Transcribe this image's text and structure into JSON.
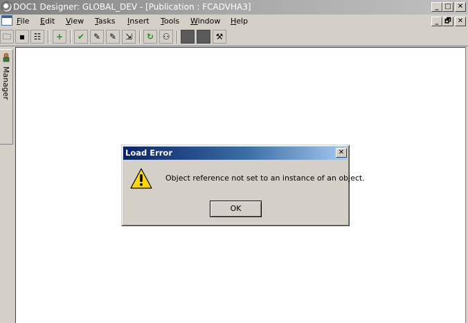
{
  "window": {
    "title": "DOC1 Designer: GLOBAL_DEV - [Publication : FCADVHA3]",
    "icon": "doc1-app-icon",
    "controls": {
      "minimize": "_",
      "maximize": "□",
      "close": "✕"
    },
    "child_controls": {
      "minimize": "_",
      "restore": "🗗",
      "close": "✕"
    }
  },
  "menu": {
    "doc_icon": "document-icon",
    "items": [
      {
        "label": "File",
        "accel": "F"
      },
      {
        "label": "Edit",
        "accel": "E"
      },
      {
        "label": "View",
        "accel": "V"
      },
      {
        "label": "Tasks",
        "accel": "T"
      },
      {
        "label": "Insert",
        "accel": "I"
      },
      {
        "label": "Tools",
        "accel": "T"
      },
      {
        "label": "Window",
        "accel": "W"
      },
      {
        "label": "Help",
        "accel": "H"
      }
    ]
  },
  "toolbar": {
    "buttons": [
      {
        "icon": "open-folder-icon",
        "glyph": "🗀"
      },
      {
        "icon": "save-icon",
        "glyph": "▪"
      },
      {
        "icon": "properties-icon",
        "glyph": "☷"
      },
      {
        "icon": "add-resource-icon",
        "glyph": "+"
      },
      {
        "icon": "check-icon",
        "glyph": "✔"
      },
      {
        "icon": "edit-document-icon",
        "glyph": "✎"
      },
      {
        "icon": "edit-list-icon",
        "glyph": "✎"
      },
      {
        "icon": "export-icon",
        "glyph": "⇲"
      },
      {
        "icon": "refresh-icon",
        "glyph": "↻"
      },
      {
        "icon": "hierarchy-icon",
        "glyph": "⚇"
      },
      {
        "icon": "gray-box-icon",
        "glyph": ""
      },
      {
        "icon": "dark-box-icon",
        "glyph": ""
      },
      {
        "icon": "tools-icon",
        "glyph": "⚒"
      }
    ]
  },
  "side_panel": {
    "tab_label": "Manager",
    "icon": "manager-icon"
  },
  "dialog": {
    "title": "Load Error",
    "close_glyph": "✕",
    "icon": "warning-icon",
    "message": "Object reference not set to an instance of an object.",
    "ok_label": "OK"
  }
}
